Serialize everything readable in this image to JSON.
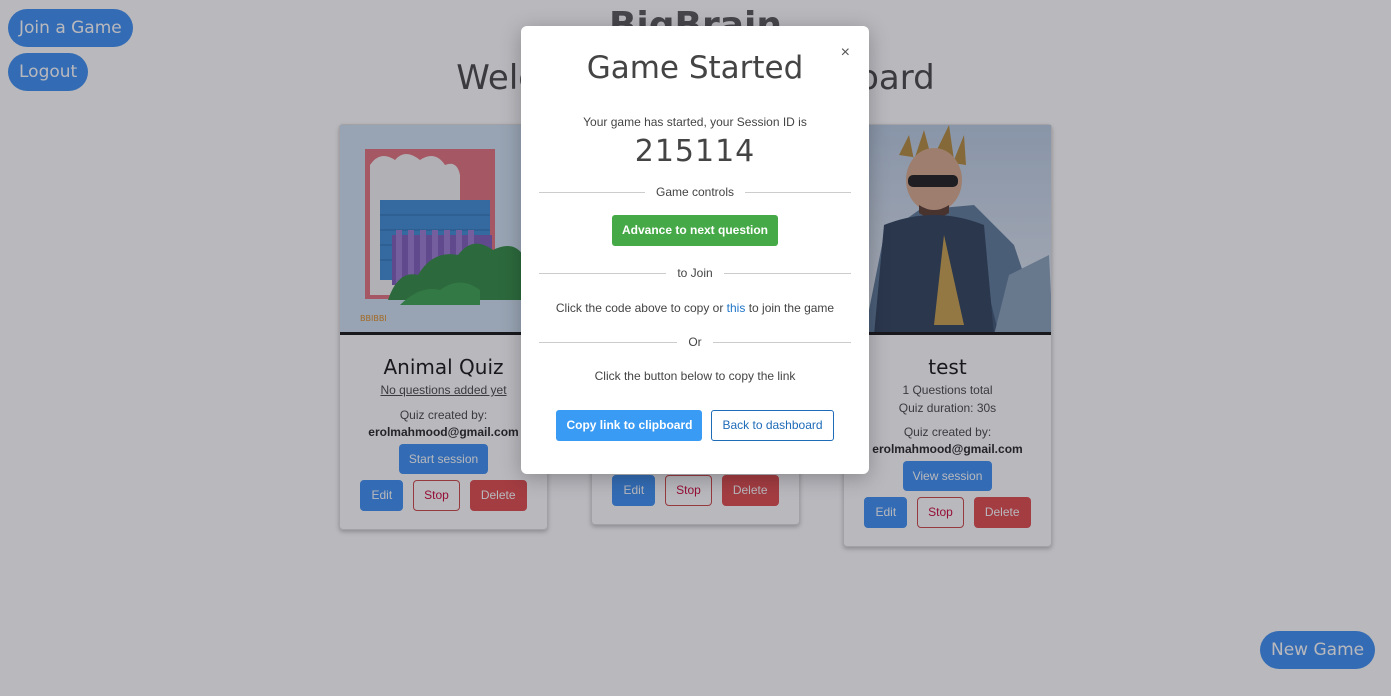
{
  "top_buttons": {
    "join": "Join a Game",
    "logout": "Logout"
  },
  "header": {
    "title": "BigBrain",
    "subtitle": "Welcome to your dashboard"
  },
  "cards": [
    {
      "name": "Animal Quiz",
      "questions_text": "No questions added yet",
      "creator_label": "Quiz created by:",
      "creator_email": "erolmahmood@gmail.com",
      "session_button": "Start session",
      "edit": "Edit",
      "stop": "Stop",
      "delete": "Delete"
    },
    {
      "edit": "Edit",
      "stop": "Stop",
      "delete": "Delete"
    },
    {
      "name": "test",
      "questions_text": "1 Questions total",
      "duration_text": "Quiz duration: 30s",
      "creator_label": "Quiz created by:",
      "creator_email": "erolmahmood@gmail.com",
      "session_button": "View session",
      "edit": "Edit",
      "stop": "Stop",
      "delete": "Delete"
    }
  ],
  "new_game": "New Game",
  "modal": {
    "title": "Game Started",
    "close": "×",
    "session_info": "Your game has started, your Session ID is",
    "session_id": "215114",
    "controls_divider": "Game controls",
    "advance_button": "Advance to next question",
    "join_divider": "to Join",
    "copy_text_before": "Click the code above to copy or",
    "copy_link": "this",
    "copy_text_after": "to join the game",
    "or_divider": "Or",
    "copy_instruction": "Click the button below to copy the link",
    "copy_button": "Copy link to clipboard",
    "back_button": "Back to dashboard"
  }
}
